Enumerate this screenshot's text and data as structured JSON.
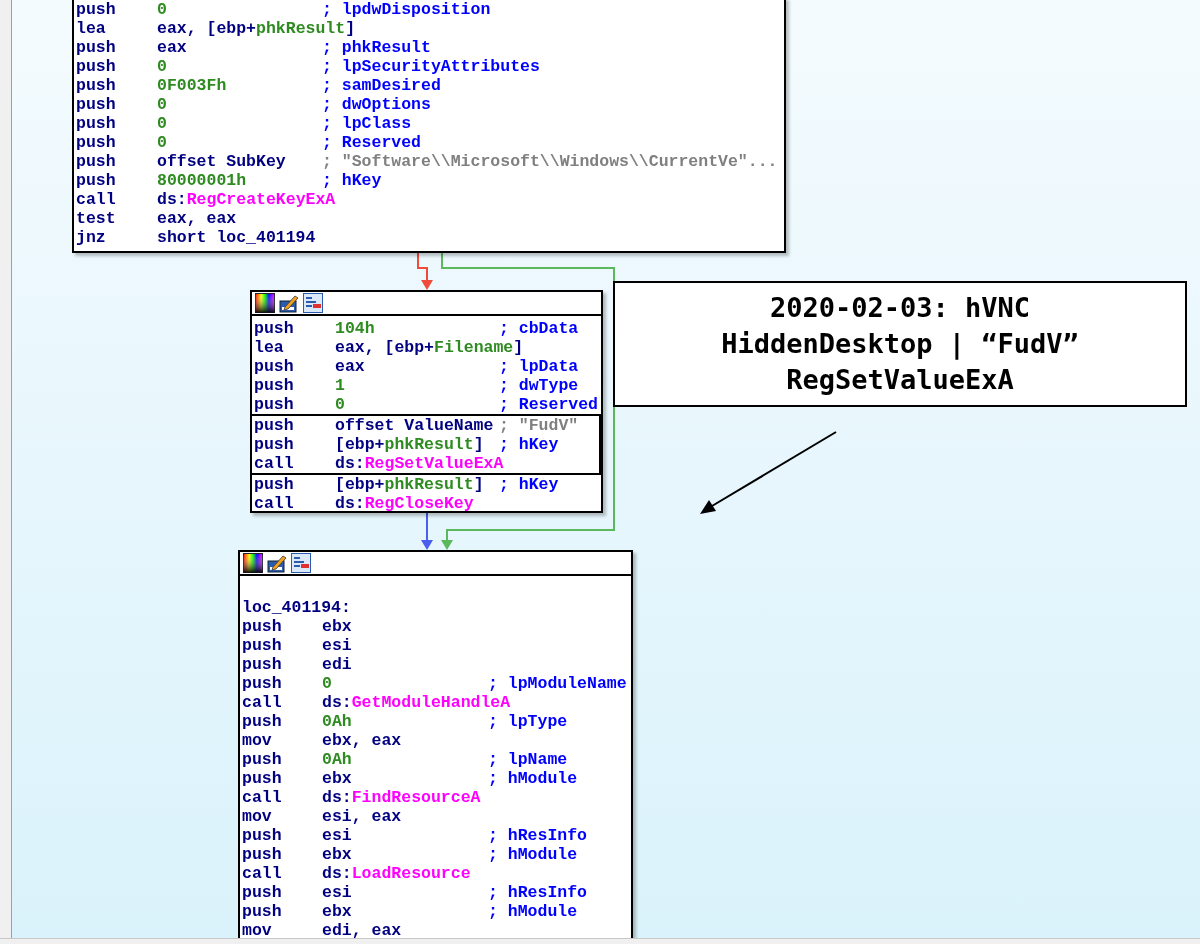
{
  "blocks": [
    {
      "toolbar": false,
      "lines": [
        {
          "mnemonic": "push",
          "operand": [
            {
              "text": "0",
              "kind": "number"
            }
          ],
          "comment": {
            "text": "; lpdwDisposition",
            "kind": "comment"
          }
        },
        {
          "mnemonic": "lea",
          "operand": [
            {
              "text": "eax, [ebp+",
              "kind": "text"
            },
            {
              "text": "phkResult",
              "kind": "name"
            },
            {
              "text": "]",
              "kind": "text"
            }
          ]
        },
        {
          "mnemonic": "push",
          "operand": [
            {
              "text": "eax",
              "kind": "text"
            }
          ],
          "comment": {
            "text": "; phkResult",
            "kind": "comment"
          }
        },
        {
          "mnemonic": "push",
          "operand": [
            {
              "text": "0",
              "kind": "number"
            }
          ],
          "comment": {
            "text": "; lpSecurityAttributes",
            "kind": "comment"
          }
        },
        {
          "mnemonic": "push",
          "operand": [
            {
              "text": "0F003Fh",
              "kind": "number"
            }
          ],
          "comment": {
            "text": "; samDesired",
            "kind": "comment"
          }
        },
        {
          "mnemonic": "push",
          "operand": [
            {
              "text": "0",
              "kind": "number"
            }
          ],
          "comment": {
            "text": "; dwOptions",
            "kind": "comment"
          }
        },
        {
          "mnemonic": "push",
          "operand": [
            {
              "text": "0",
              "kind": "number"
            }
          ],
          "comment": {
            "text": "; lpClass",
            "kind": "comment"
          }
        },
        {
          "mnemonic": "push",
          "operand": [
            {
              "text": "0",
              "kind": "number"
            }
          ],
          "comment": {
            "text": "; Reserved",
            "kind": "comment"
          }
        },
        {
          "mnemonic": "push",
          "operand": [
            {
              "text": "offset SubKey",
              "kind": "text"
            }
          ],
          "comment": {
            "text": "; \"Software\\\\Microsoft\\\\Windows\\\\CurrentVe\"...",
            "kind": "string"
          }
        },
        {
          "mnemonic": "push",
          "operand": [
            {
              "text": "80000001h",
              "kind": "number"
            }
          ],
          "comment": {
            "text": "; hKey",
            "kind": "comment"
          }
        },
        {
          "mnemonic": "call",
          "operand": [
            {
              "text": "ds:",
              "kind": "text"
            },
            {
              "text": "RegCreateKeyExA",
              "kind": "import"
            }
          ]
        },
        {
          "mnemonic": "test",
          "operand": [
            {
              "text": "eax, eax",
              "kind": "text"
            }
          ]
        },
        {
          "mnemonic": "jnz",
          "operand": [
            {
              "text": "short loc_401194",
              "kind": "text"
            }
          ]
        }
      ]
    },
    {
      "toolbar": true,
      "lines": [
        {
          "mnemonic": "push",
          "operand": [
            {
              "text": "104h",
              "kind": "number"
            }
          ],
          "comment": {
            "text": "; cbData",
            "kind": "comment"
          },
          "boxed": false
        },
        {
          "mnemonic": "lea",
          "operand": [
            {
              "text": "eax, [ebp+",
              "kind": "text"
            },
            {
              "text": "Filename",
              "kind": "name"
            },
            {
              "text": "]",
              "kind": "text"
            }
          ],
          "boxed": false
        },
        {
          "mnemonic": "push",
          "operand": [
            {
              "text": "eax",
              "kind": "text"
            }
          ],
          "comment": {
            "text": "; lpData",
            "kind": "comment"
          },
          "boxed": false
        },
        {
          "mnemonic": "push",
          "operand": [
            {
              "text": "1",
              "kind": "number"
            }
          ],
          "comment": {
            "text": "; dwType",
            "kind": "comment"
          },
          "boxed": false
        },
        {
          "mnemonic": "push",
          "operand": [
            {
              "text": "0",
              "kind": "number"
            }
          ],
          "comment": {
            "text": "; Reserved",
            "kind": "comment"
          },
          "boxed": false
        },
        {
          "mnemonic": "push",
          "operand": [
            {
              "text": "offset ValueName",
              "kind": "text"
            }
          ],
          "comment": {
            "text": "; \"FudV\"",
            "kind": "string"
          },
          "boxed": true
        },
        {
          "mnemonic": "push",
          "operand": [
            {
              "text": "[ebp+",
              "kind": "text"
            },
            {
              "text": "phkResult",
              "kind": "name"
            },
            {
              "text": "]",
              "kind": "text"
            }
          ],
          "comment": {
            "text": "; hKey",
            "kind": "comment"
          },
          "boxed": true
        },
        {
          "mnemonic": "call",
          "operand": [
            {
              "text": "ds:",
              "kind": "text"
            },
            {
              "text": "RegSetValueExA",
              "kind": "import"
            }
          ],
          "boxed": true
        },
        {
          "mnemonic": "push",
          "operand": [
            {
              "text": "[ebp+",
              "kind": "text"
            },
            {
              "text": "phkResult",
              "kind": "name"
            },
            {
              "text": "]",
              "kind": "text"
            }
          ],
          "comment": {
            "text": "; hKey",
            "kind": "comment"
          },
          "boxed": false
        },
        {
          "mnemonic": "call",
          "operand": [
            {
              "text": "ds:",
              "kind": "text"
            },
            {
              "text": "RegCloseKey",
              "kind": "import"
            }
          ],
          "boxed": false
        }
      ]
    },
    {
      "toolbar": true,
      "label": "loc_401194:",
      "lines": [
        {
          "mnemonic": "push",
          "operand": [
            {
              "text": "ebx",
              "kind": "text"
            }
          ]
        },
        {
          "mnemonic": "push",
          "operand": [
            {
              "text": "esi",
              "kind": "text"
            }
          ]
        },
        {
          "mnemonic": "push",
          "operand": [
            {
              "text": "edi",
              "kind": "text"
            }
          ]
        },
        {
          "mnemonic": "push",
          "operand": [
            {
              "text": "0",
              "kind": "number"
            }
          ],
          "comment": {
            "text": "; lpModuleName",
            "kind": "comment"
          }
        },
        {
          "mnemonic": "call",
          "operand": [
            {
              "text": "ds:",
              "kind": "text"
            },
            {
              "text": "GetModuleHandleA",
              "kind": "import"
            }
          ]
        },
        {
          "mnemonic": "push",
          "operand": [
            {
              "text": "0Ah",
              "kind": "number"
            }
          ],
          "comment": {
            "text": "; lpType",
            "kind": "comment"
          }
        },
        {
          "mnemonic": "mov",
          "operand": [
            {
              "text": "ebx, eax",
              "kind": "text"
            }
          ]
        },
        {
          "mnemonic": "push",
          "operand": [
            {
              "text": "0Ah",
              "kind": "number"
            }
          ],
          "comment": {
            "text": "; lpName",
            "kind": "comment"
          }
        },
        {
          "mnemonic": "push",
          "operand": [
            {
              "text": "ebx",
              "kind": "text"
            }
          ],
          "comment": {
            "text": "; hModule",
            "kind": "comment"
          }
        },
        {
          "mnemonic": "call",
          "operand": [
            {
              "text": "ds:",
              "kind": "text"
            },
            {
              "text": "FindResourceA",
              "kind": "import"
            }
          ]
        },
        {
          "mnemonic": "mov",
          "operand": [
            {
              "text": "esi, eax",
              "kind": "text"
            }
          ]
        },
        {
          "mnemonic": "push",
          "operand": [
            {
              "text": "esi",
              "kind": "text"
            }
          ],
          "comment": {
            "text": "; hResInfo",
            "kind": "comment"
          }
        },
        {
          "mnemonic": "push",
          "operand": [
            {
              "text": "ebx",
              "kind": "text"
            }
          ],
          "comment": {
            "text": "; hModule",
            "kind": "comment"
          }
        },
        {
          "mnemonic": "call",
          "operand": [
            {
              "text": "ds:",
              "kind": "text"
            },
            {
              "text": "LoadResource",
              "kind": "import"
            }
          ]
        },
        {
          "mnemonic": "push",
          "operand": [
            {
              "text": "esi",
              "kind": "text"
            }
          ],
          "comment": {
            "text": "; hResInfo",
            "kind": "comment"
          }
        },
        {
          "mnemonic": "push",
          "operand": [
            {
              "text": "ebx",
              "kind": "text"
            }
          ],
          "comment": {
            "text": "; hModule",
            "kind": "comment"
          }
        },
        {
          "mnemonic": "mov",
          "operand": [
            {
              "text": "edi, eax",
              "kind": "text"
            }
          ]
        }
      ]
    }
  ],
  "edges": [
    {
      "color": "#f04a3a"
    },
    {
      "color": "#5cb85c"
    },
    {
      "color": "#4a5ef0"
    }
  ],
  "annotation": {
    "lines": [
      "2020-02-03: hVNC",
      "HiddenDesktop | “FudV”",
      "RegSetValueExA"
    ]
  }
}
